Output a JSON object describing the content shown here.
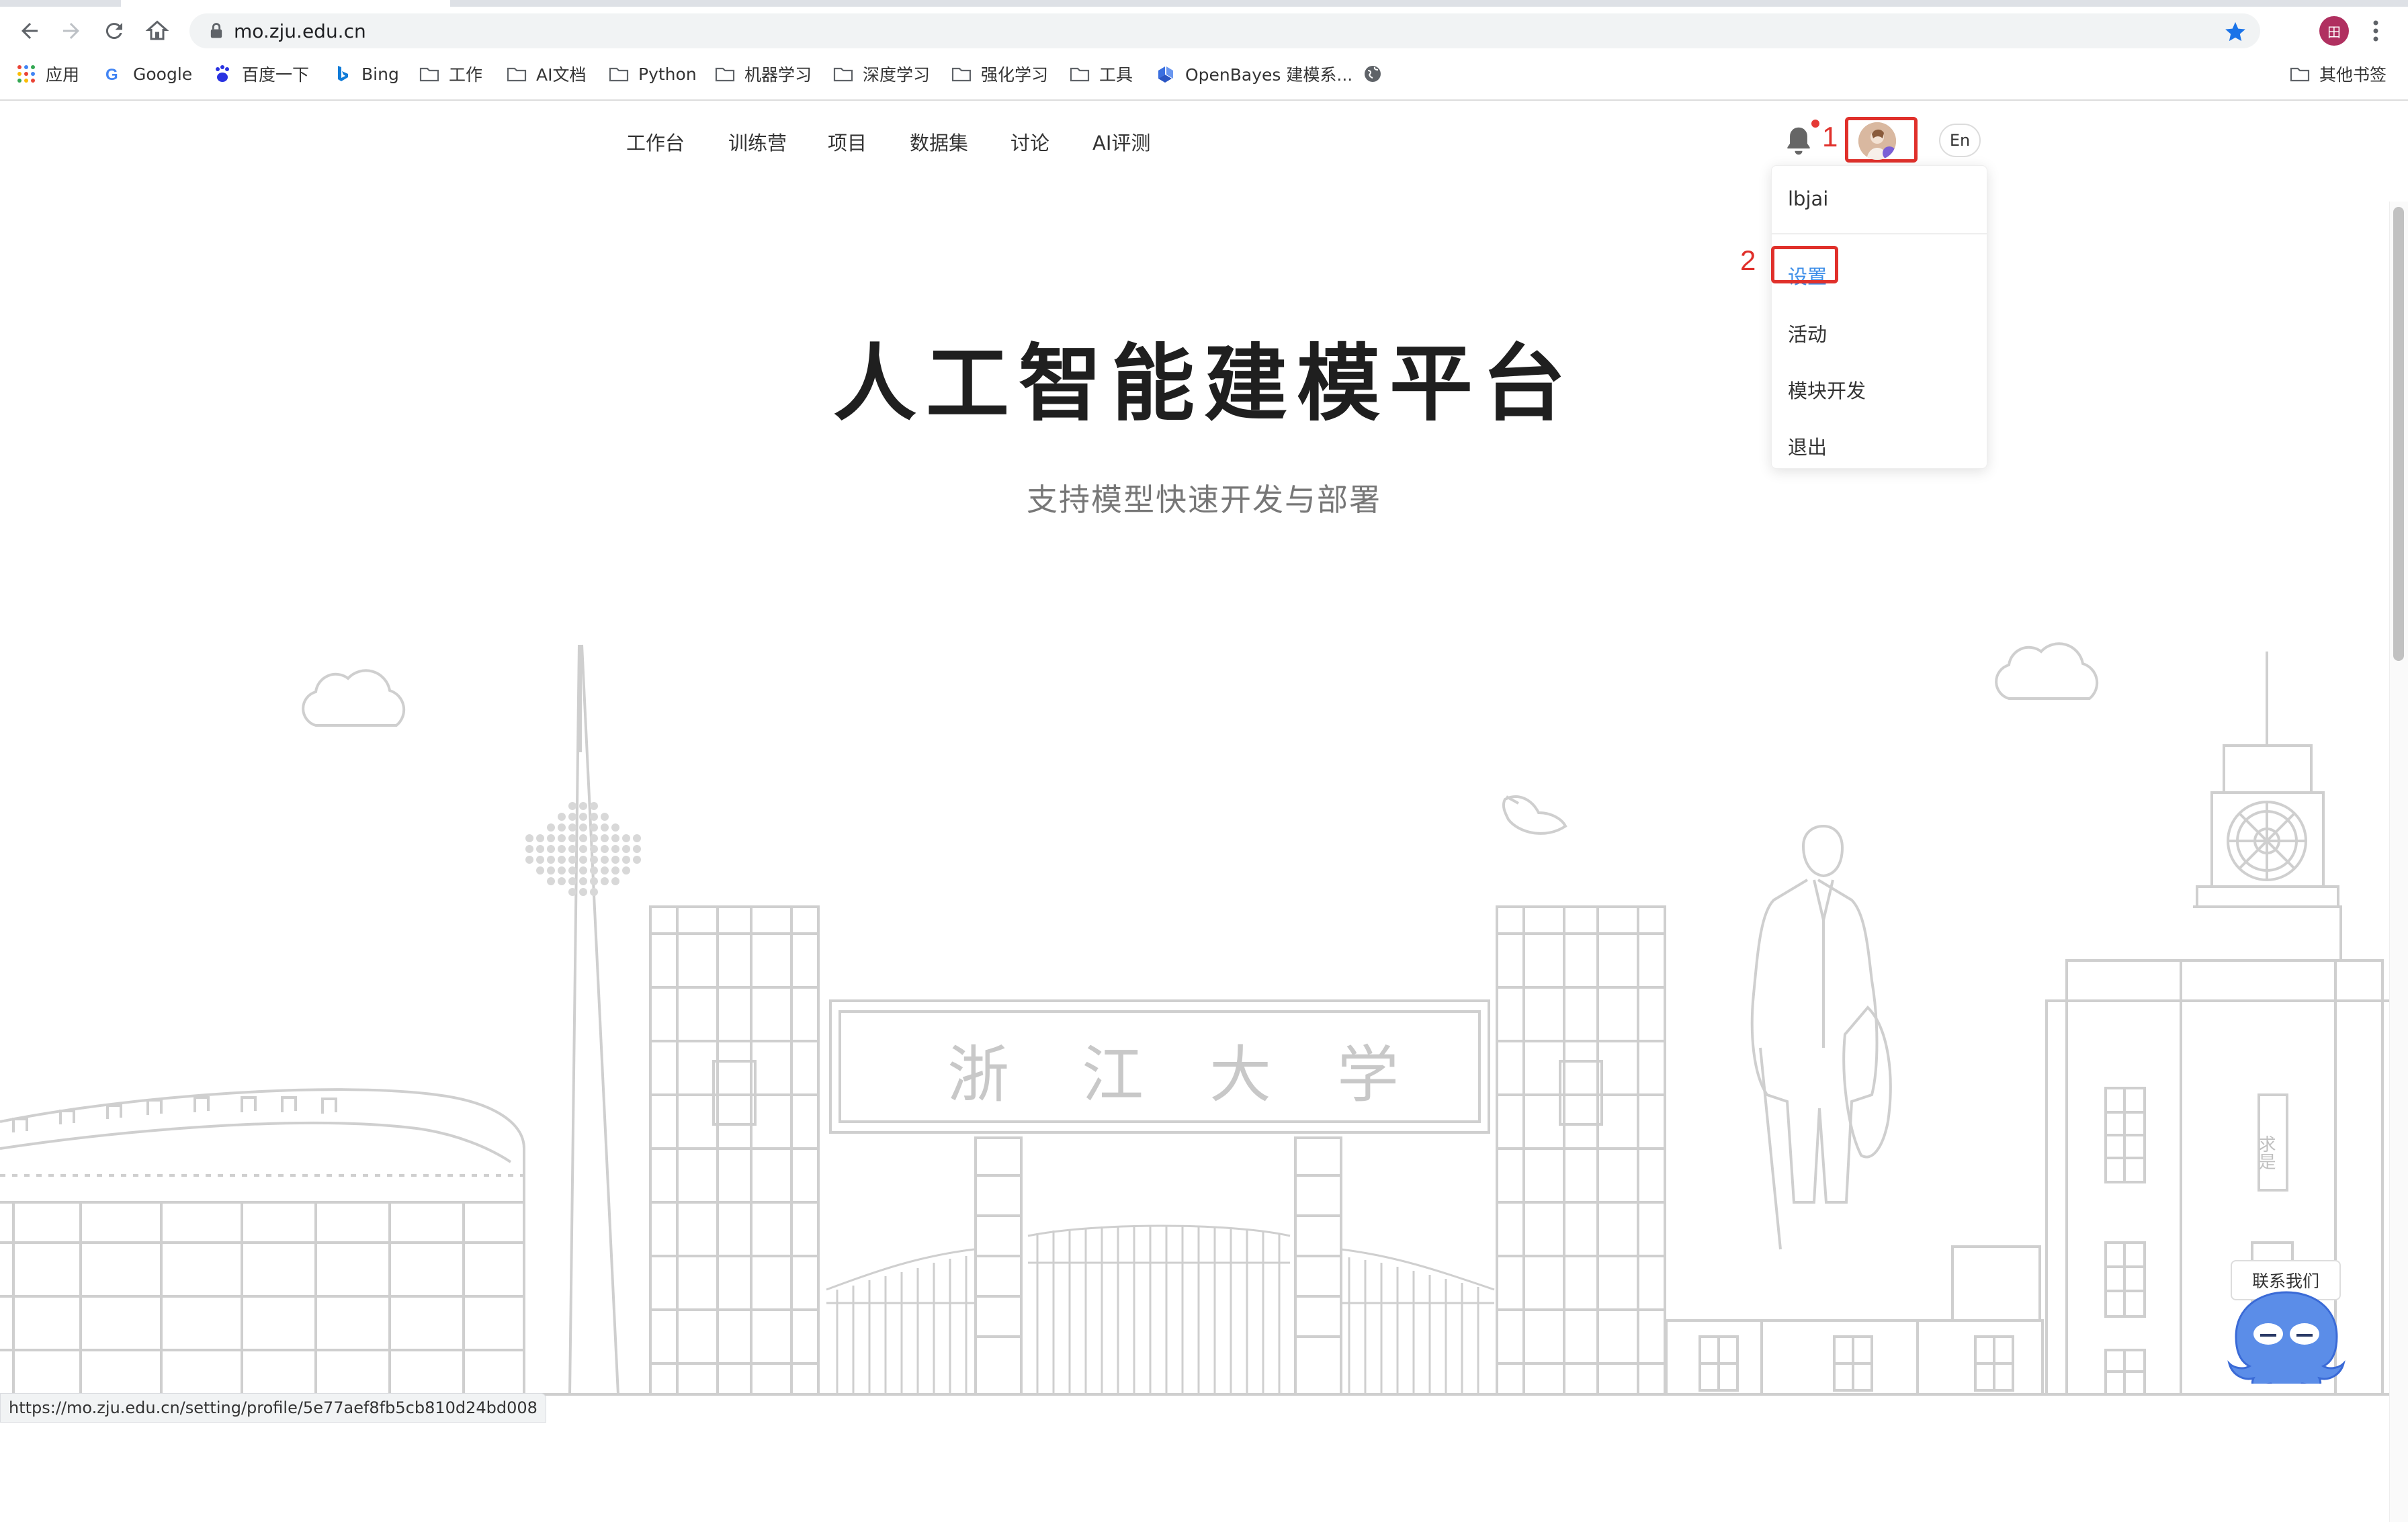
{
  "browser": {
    "url": "mo.zju.edu.cn",
    "status_url": "https://mo.zju.edu.cn/setting/profile/5e77aef8fb5cb810d24bd008",
    "profile_initial": "田",
    "bookmarks": [
      {
        "label": "应用",
        "icon": "apps-grid-icon"
      },
      {
        "label": "Google",
        "icon": "google-icon"
      },
      {
        "label": "百度一下",
        "icon": "baidu-icon"
      },
      {
        "label": "Bing",
        "icon": "bing-icon"
      },
      {
        "label": "工作",
        "icon": "folder-icon"
      },
      {
        "label": "AI文档",
        "icon": "folder-icon"
      },
      {
        "label": "Python",
        "icon": "folder-icon"
      },
      {
        "label": "机器学习",
        "icon": "folder-icon"
      },
      {
        "label": "深度学习",
        "icon": "folder-icon"
      },
      {
        "label": "强化学习",
        "icon": "folder-icon"
      },
      {
        "label": "工具",
        "icon": "folder-icon"
      },
      {
        "label": "OpenBayes 建模系...",
        "icon": "openbayes-icon"
      },
      {
        "label": "",
        "icon": "globe-icon"
      }
    ],
    "other_bookmarks": "其他书签"
  },
  "topnav": {
    "items": [
      "工作台",
      "训练营",
      "项目",
      "数据集",
      "讨论",
      "AI评测"
    ],
    "lang_button": "En"
  },
  "annotations": {
    "step1": "1",
    "step2": "2"
  },
  "user_menu": {
    "username": "lbjai",
    "items": [
      "设置",
      "活动",
      "模块开发",
      "退出"
    ],
    "active_item": "设置"
  },
  "hero": {
    "title": "人工智能建模平台",
    "subtitle": "支持模型快速开发与部署"
  },
  "illustration": {
    "gate_inscription": [
      "浙",
      "江",
      "大",
      "学"
    ],
    "tower_plaque": "求是"
  },
  "contact": {
    "label": "联系我们"
  },
  "colors": {
    "annotation_red": "#e0302b",
    "active_link_blue": "#3d8ee8",
    "line_art_gray": "#cfcfcf"
  }
}
